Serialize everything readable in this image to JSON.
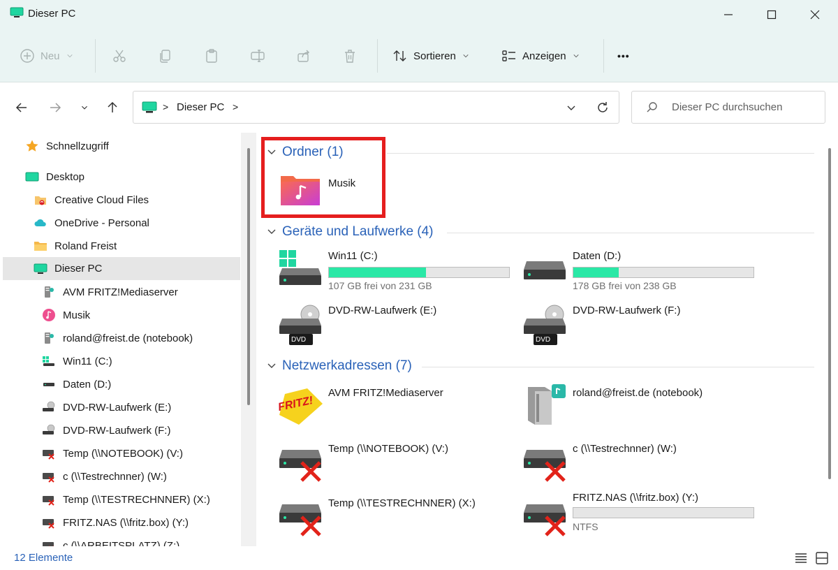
{
  "window": {
    "title": "Dieser PC",
    "accent": "#eaf4f3"
  },
  "toolbar": {
    "new_label": "Neu",
    "sort_label": "Sortieren",
    "view_label": "Anzeigen",
    "more_label": "•••"
  },
  "address": {
    "crumb": "Dieser PC",
    "separator": ">"
  },
  "search": {
    "placeholder": "Dieser PC durchsuchen"
  },
  "sidebar": {
    "items": [
      {
        "label": "Schnellzugriff",
        "icon": "star-icon"
      },
      {
        "label": "Desktop",
        "icon": "desktop-icon"
      },
      {
        "label": "Creative Cloud Files",
        "icon": "creative-cloud-folder-icon"
      },
      {
        "label": "OneDrive - Personal",
        "icon": "onedrive-cloud-icon"
      },
      {
        "label": "Roland Freist",
        "icon": "user-folder-icon"
      },
      {
        "label": "Dieser PC",
        "icon": "pc-icon",
        "selected": true
      },
      {
        "label": "AVM FRITZ!Mediaserver",
        "icon": "media-server-icon"
      },
      {
        "label": "Musik",
        "icon": "music-icon"
      },
      {
        "label": "roland@freist.de (notebook)",
        "icon": "media-server-icon"
      },
      {
        "label": "Win11 (C:)",
        "icon": "windows-drive-icon"
      },
      {
        "label": "Daten (D:)",
        "icon": "drive-icon"
      },
      {
        "label": "DVD-RW-Laufwerk (E:)",
        "icon": "dvd-drive-icon"
      },
      {
        "label": "DVD-RW-Laufwerk (F:)",
        "icon": "dvd-drive-icon"
      },
      {
        "label": "Temp (\\\\NOTEBOOK) (V:)",
        "icon": "disconnected-network-drive-icon"
      },
      {
        "label": "c (\\\\Testrechnner) (W:)",
        "icon": "disconnected-network-drive-icon"
      },
      {
        "label": "Temp (\\\\TESTRECHNNER) (X:)",
        "icon": "disconnected-network-drive-icon"
      },
      {
        "label": "FRITZ.NAS (\\\\fritz.box) (Y:)",
        "icon": "disconnected-network-drive-icon"
      },
      {
        "label": "c (\\\\ARBEITSPLATZ) (Z:)",
        "icon": "disconnected-network-drive-icon"
      }
    ]
  },
  "groups": {
    "folders": {
      "header": "Ordner (1)",
      "items": [
        {
          "name": "Musik",
          "icon": "music-folder-icon"
        }
      ]
    },
    "drives": {
      "header": "Geräte und Laufwerke (4)",
      "items": [
        {
          "name": "Win11 (C:)",
          "sub": "107 GB frei von 231 GB",
          "used_fraction": 0.54,
          "icon": "windows-drive-icon"
        },
        {
          "name": "Daten (D:)",
          "sub": "178 GB frei von 238 GB",
          "used_fraction": 0.25,
          "icon": "drive-icon"
        },
        {
          "name": "DVD-RW-Laufwerk (E:)",
          "icon": "dvd-drive-icon",
          "badge": "DVD"
        },
        {
          "name": "DVD-RW-Laufwerk (F:)",
          "icon": "dvd-drive-icon",
          "badge": "DVD"
        }
      ]
    },
    "network": {
      "header": "Netzwerkadressen (7)",
      "items": [
        {
          "name": "AVM FRITZ!Mediaserver",
          "icon": "fritz-logo-icon",
          "logo_text": "FRITZ!"
        },
        {
          "name": "roland@freist.de (notebook)",
          "icon": "media-server-icon"
        },
        {
          "name": "Temp (\\\\NOTEBOOK) (V:)",
          "icon": "disconnected-network-drive-icon"
        },
        {
          "name": "c (\\\\Testrechnner) (W:)",
          "icon": "disconnected-network-drive-icon"
        },
        {
          "name": "Temp (\\\\TESTRECHNNER) (X:)",
          "icon": "disconnected-network-drive-icon"
        },
        {
          "name": "FRITZ.NAS (\\\\fritz.box) (Y:)",
          "sub": "NTFS",
          "used_fraction": 0,
          "icon": "disconnected-network-drive-icon"
        }
      ]
    }
  },
  "status": {
    "count": "12 Elemente"
  },
  "colors": {
    "link_blue": "#2a62b8",
    "bar_fill": "#2ae8a6",
    "highlight_red": "#e51e1e"
  }
}
